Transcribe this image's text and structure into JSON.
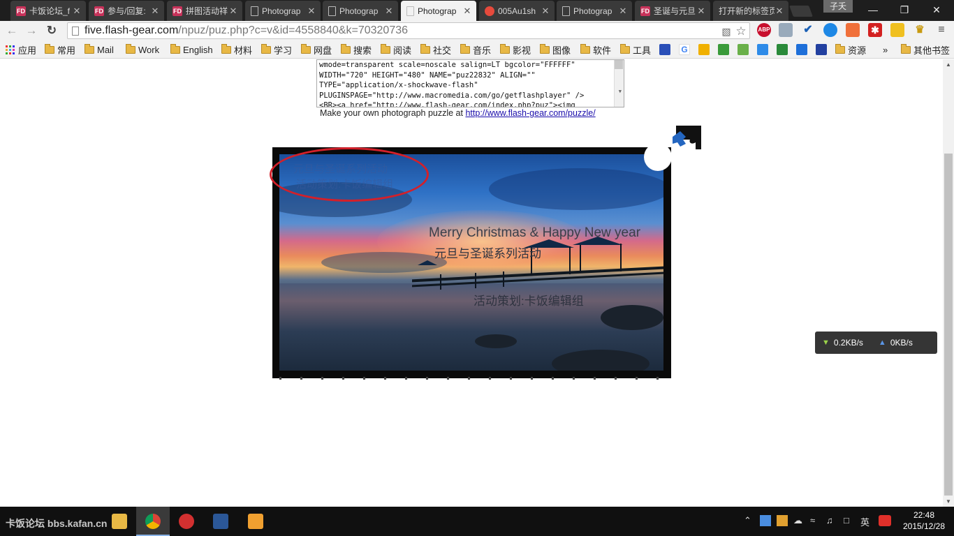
{
  "tabs": [
    {
      "title": "卡饭论坛_f",
      "icon": "kafan"
    },
    {
      "title": "参与/回复:",
      "icon": "kafan"
    },
    {
      "title": "拼图活动祥",
      "icon": "kafan"
    },
    {
      "title": "Photograp",
      "icon": "page"
    },
    {
      "title": "Photograp",
      "icon": "page"
    },
    {
      "title": "Photograp",
      "icon": "page"
    },
    {
      "title": "005Au1sh",
      "icon": "weibo"
    },
    {
      "title": "Photograp",
      "icon": "page"
    },
    {
      "title": "圣诞与元旦",
      "icon": "kafan"
    },
    {
      "title": "打开新的标签页",
      "icon": "none"
    }
  ],
  "window": {
    "user": "子夭",
    "minimize": "—",
    "restore": "❐",
    "close": "✕"
  },
  "toolbar": {
    "url_host": "five.flash-gear.com",
    "url_path": "/npuz/puz.php?c=v&id=4558840&k=70320736"
  },
  "bookmarks": {
    "apps_label": "应用",
    "folders": [
      "常用",
      "Mail",
      "Work",
      "English",
      "材料",
      "学习",
      "网盘",
      "搜索",
      "阅读",
      "社交",
      "音乐",
      "影视",
      "图像",
      "软件",
      "工具"
    ],
    "folders_right": [
      "资源"
    ],
    "overflow": "»",
    "other": "其他书签"
  },
  "page": {
    "embed_code_lines": [
      "wmode=transparent scale=noscale salign=LT bgcolor=\"FFFFFF\"",
      "WIDTH=\"720\" HEIGHT=\"480\" NAME=\"puz22832\" ALIGN=\"\"",
      "TYPE=\"application/x-shockwave-flash\"",
      "PLUGINSPAGE=\"http://www.macromedia.com/go/getflashplayer\" />",
      "<BR><a href=\"http://www.flash-gear.com/index.php?puz\"><img"
    ],
    "make_own_text": "Make your own photograph puzzle at ",
    "make_own_link": "http://www.flash-gear.com/puzzle/",
    "puzzle": {
      "greeting": "Merry Christmas & Happy New year",
      "subtitle": "元旦与圣诞系列活动",
      "credit": "活动策划:卡饭编辑组"
    }
  },
  "speed": {
    "down": "0.2KB/s",
    "up": "0KB/s"
  },
  "taskbar": {
    "watermark": "卡饭论坛 bbs.kafan.cn",
    "ime": "英",
    "time": "22:48",
    "date": "2015/12/28"
  }
}
